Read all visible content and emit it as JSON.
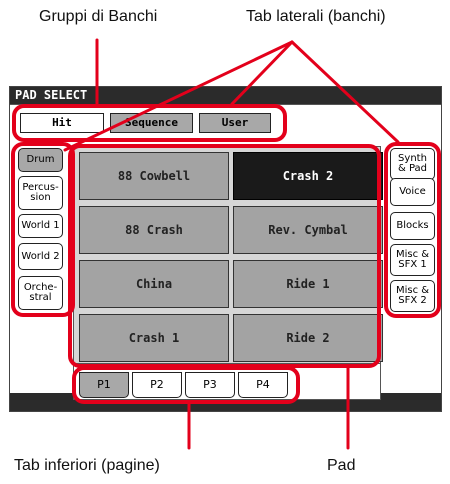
{
  "captions": {
    "bank_groups": "Gruppi di Banchi",
    "side_tabs": "Tab laterali (banchi)",
    "bottom_tabs": "Tab inferiori (pagine)",
    "pad": "Pad"
  },
  "window": {
    "title": "PAD SELECT"
  },
  "bank_groups": [
    {
      "label": "Hit",
      "selected": true
    },
    {
      "label": "Sequence",
      "selected": false
    },
    {
      "label": "User",
      "selected": false
    }
  ],
  "left_tabs": [
    {
      "label": "Drum",
      "selected": true
    },
    {
      "label": "Percus-\nsion",
      "selected": false
    },
    {
      "label": "World 1",
      "selected": false
    },
    {
      "label": "World 2",
      "selected": false
    },
    {
      "label": "Orche-\nstral",
      "selected": false
    }
  ],
  "right_tabs": [
    {
      "label": "Synth\n& Pad",
      "selected": false
    },
    {
      "label": "Voice",
      "selected": false
    },
    {
      "label": "Blocks",
      "selected": false
    },
    {
      "label": "Misc &\nSFX 1",
      "selected": false
    },
    {
      "label": "Misc &\nSFX 2",
      "selected": false
    }
  ],
  "pads": [
    {
      "label": "88 Cowbell",
      "selected": false
    },
    {
      "label": "Crash 2",
      "selected": true
    },
    {
      "label": "88 Crash",
      "selected": false
    },
    {
      "label": "Rev. Cymbal",
      "selected": false
    },
    {
      "label": "China",
      "selected": false
    },
    {
      "label": "Ride 1",
      "selected": false
    },
    {
      "label": "Crash 1",
      "selected": false
    },
    {
      "label": "Ride 2",
      "selected": false
    }
  ],
  "page_tabs": [
    {
      "label": "P1",
      "selected": true
    },
    {
      "label": "P2",
      "selected": false
    },
    {
      "label": "P3",
      "selected": false
    },
    {
      "label": "P4",
      "selected": false
    }
  ],
  "colors": {
    "highlight": "#e3001b",
    "selected_tab": "#a8a8a8",
    "pad": "#a3a3a3",
    "selected_pad": "#1a1a1a"
  }
}
